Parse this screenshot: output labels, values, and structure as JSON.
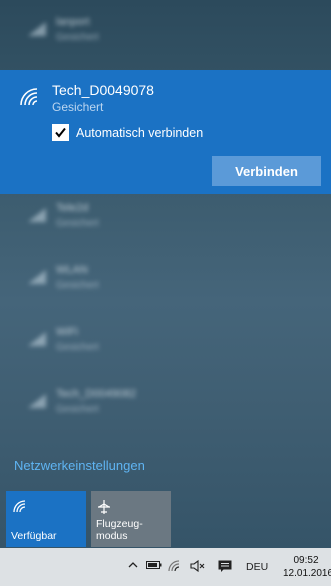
{
  "networks_blurred": [
    {
      "name": "lanport",
      "status": "Gesichert"
    },
    {
      "name": "Tele2d",
      "status": "Gesichert"
    },
    {
      "name": "WLAN",
      "status": "Gesichert"
    },
    {
      "name": "WiFi",
      "status": "Gesichert"
    },
    {
      "name": "Tech_D0049082",
      "status": "Gesichert"
    }
  ],
  "selected_network": {
    "name": "Tech_D0049078",
    "status": "Gesichert",
    "auto_connect_label": "Automatisch verbinden",
    "auto_connect_checked": true,
    "connect_button": "Verbinden"
  },
  "network_settings_link": "Netzwerkeinstellungen",
  "quick_actions": {
    "wifi_tile": "Verfügbar",
    "airplane_tile_line1": "Flugzeug-",
    "airplane_tile_line2": "modus"
  },
  "taskbar": {
    "language": "DEU",
    "time": "09:52",
    "date": "12.01.2016"
  },
  "colors": {
    "accent": "#1b72c4",
    "connect_button": "#5b9ad8",
    "link": "#5fb4f2"
  }
}
